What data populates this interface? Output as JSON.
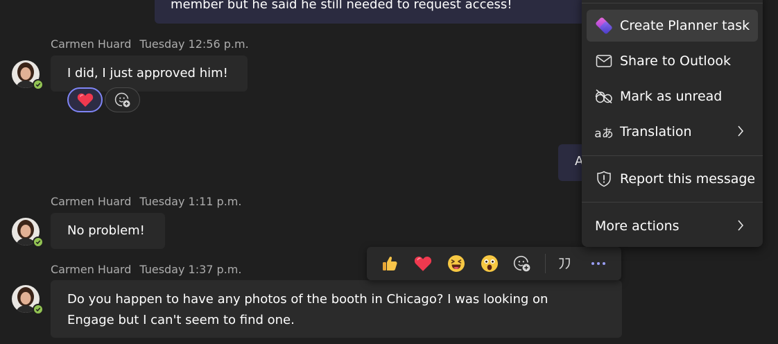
{
  "top_message": {
    "text": "member but he said he still needed to request access!"
  },
  "partial_message": {
    "text": "A"
  },
  "messages": [
    {
      "author": "Carmen Huard",
      "time": "Tuesday 12:56 p.m.",
      "text": "I did, I just approved him!",
      "reaction": "heart"
    },
    {
      "author": "Carmen Huard",
      "time": "Tuesday 1:11 p.m.",
      "text": "No problem!"
    },
    {
      "author": "Carmen Huard",
      "time": "Tuesday 1:37 p.m.",
      "text_line1": "Do you happen to have any photos of the booth in Chicago? I was looking on",
      "text_line2": "Engage but I can't seem to find one."
    }
  ],
  "context_menu": {
    "items": [
      {
        "label": "Create Planner task",
        "icon": "planner-icon"
      },
      {
        "label": "Share to Outlook",
        "icon": "mail-icon"
      },
      {
        "label": "Mark as unread",
        "icon": "mark-unread-icon"
      },
      {
        "label": "Translation",
        "icon": "translate-icon",
        "submenu": true
      },
      {
        "label": "Report this message",
        "icon": "shield-icon"
      },
      {
        "label": "More actions",
        "submenu": true
      }
    ]
  },
  "reaction_toolbar": {
    "items": [
      "like",
      "heart",
      "laugh",
      "surprised",
      "add-reaction",
      "quote",
      "more-options"
    ]
  },
  "colors": {
    "background": "#1f1f1f",
    "bubble_incoming": "#292929",
    "bubble_outgoing": "#2b2b40",
    "accent": "#7f85f5",
    "presence_available": "#92c353"
  }
}
